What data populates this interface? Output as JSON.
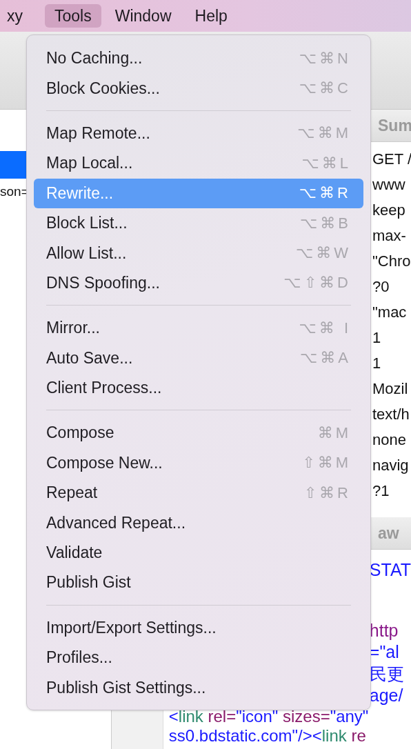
{
  "menubar": [
    {
      "label": "xy",
      "selected": false
    },
    {
      "label": "Tools",
      "selected": true
    },
    {
      "label": "Window",
      "selected": false
    },
    {
      "label": "Help",
      "selected": false
    }
  ],
  "left_pane": {
    "selected_row": true,
    "row_text": "son="
  },
  "summary": {
    "header": "Sum",
    "values": [
      "GET /",
      "www",
      "keep",
      "max-",
      "\"Chro",
      "?0",
      "\"mac",
      "1",
      "1",
      "Mozil",
      "text/h",
      "none",
      "navig",
      "?1"
    ]
  },
  "raw": {
    "header": "aw",
    "lines": [
      {
        "kind": "cut",
        "segments": [
          {
            "text": "STAT",
            "color": "#1a1aff"
          }
        ]
      },
      {
        "kind": "blank"
      },
      {
        "kind": "blank"
      },
      {
        "kind": "cut",
        "segments": [
          {
            "text": "http",
            "color": "#8a1a8a"
          }
        ]
      },
      {
        "kind": "cut",
        "segments": [
          {
            "text": "=\"al",
            "color": "#1a1aff"
          }
        ]
      },
      {
        "kind": "cut",
        "segments": [
          {
            "text": "民更",
            "color": "#1a1aff"
          }
        ]
      },
      {
        "kind": "cut",
        "segments": [
          {
            "text": "age/",
            "color": "#1a1aff"
          }
        ]
      },
      {
        "kind": "full",
        "segments": [
          {
            "text": "<",
            "color": "#1a1aff"
          },
          {
            "text": "link",
            "color": "#2e8a6e"
          },
          {
            "text": " rel=",
            "color": "#8a1a6a"
          },
          {
            "text": "\"icon\"",
            "color": "#1a1aff"
          },
          {
            "text": " sizes=",
            "color": "#8a1a6a"
          },
          {
            "text": "\"any\"",
            "color": "#1a1aff"
          }
        ]
      },
      {
        "kind": "full",
        "segments": [
          {
            "text": "ss0.bdstatic.com\"/><",
            "color": "#1a1aff"
          },
          {
            "text": "link",
            "color": "#2e8a6e"
          },
          {
            "text": " re",
            "color": "#8a1a6a"
          }
        ]
      }
    ]
  },
  "menu": [
    {
      "kind": "item",
      "label": "No Caching...",
      "shortcut": "⌥⌘N",
      "selected": false
    },
    {
      "kind": "item",
      "label": "Block Cookies...",
      "shortcut": "⌥⌘C",
      "selected": false
    },
    {
      "kind": "separator"
    },
    {
      "kind": "item",
      "label": "Map Remote...",
      "shortcut": "⌥⌘M",
      "selected": false
    },
    {
      "kind": "item",
      "label": "Map Local...",
      "shortcut": "⌥⌘L",
      "selected": false
    },
    {
      "kind": "item",
      "label": "Rewrite...",
      "shortcut": "⌥⌘R",
      "selected": true
    },
    {
      "kind": "item",
      "label": "Block List...",
      "shortcut": "⌥⌘B",
      "selected": false
    },
    {
      "kind": "item",
      "label": "Allow List...",
      "shortcut": "⌥⌘W",
      "selected": false
    },
    {
      "kind": "item",
      "label": "DNS Spoofing...",
      "shortcut": "⌥⇧⌘D",
      "selected": false
    },
    {
      "kind": "separator"
    },
    {
      "kind": "item",
      "label": "Mirror...",
      "shortcut": "⌥⌘ I",
      "selected": false
    },
    {
      "kind": "item",
      "label": "Auto Save...",
      "shortcut": "⌥⌘A",
      "selected": false
    },
    {
      "kind": "item",
      "label": "Client Process...",
      "selected": false
    },
    {
      "kind": "separator"
    },
    {
      "kind": "item",
      "label": "Compose",
      "shortcut": "⌘M",
      "selected": false
    },
    {
      "kind": "item",
      "label": "Compose New...",
      "shortcut": "⇧⌘M",
      "selected": false
    },
    {
      "kind": "item",
      "label": "Repeat",
      "shortcut": "⇧⌘R",
      "selected": false
    },
    {
      "kind": "item",
      "label": "Advanced Repeat...",
      "selected": false
    },
    {
      "kind": "item",
      "label": "Validate",
      "selected": false
    },
    {
      "kind": "item",
      "label": "Publish Gist",
      "selected": false
    },
    {
      "kind": "separator"
    },
    {
      "kind": "item",
      "label": "Import/Export Settings...",
      "selected": false
    },
    {
      "kind": "item",
      "label": "Profiles...",
      "selected": false
    },
    {
      "kind": "item",
      "label": "Publish Gist Settings...",
      "selected": false
    }
  ]
}
